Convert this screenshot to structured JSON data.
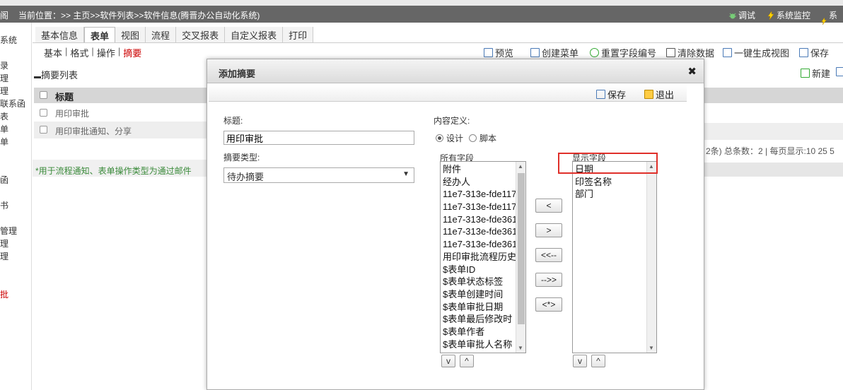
{
  "header": {
    "left_cut": "阁",
    "location": "当前位置：>> 主页>>软件列表>>软件信息(腾晋办公自动化系统)",
    "tools": [
      "调试",
      "系统监控",
      "系统"
    ]
  },
  "sidebar": {
    "items": [
      "系统",
      "录",
      "理",
      "理",
      "联系函",
      "表",
      "单",
      "单",
      "函",
      "书",
      "管理",
      "理",
      "理",
      "批"
    ]
  },
  "tabs": [
    "基本信息",
    "表单",
    "视图",
    "流程",
    "交叉报表",
    "自定义报表",
    "打印"
  ],
  "subtabs": {
    "items": [
      "基本",
      "格式",
      "操作",
      "摘要"
    ],
    "active": "摘要"
  },
  "toolbar": [
    "预览",
    "创建菜单",
    "重置字段编号",
    "清除数据",
    "一键生成视图",
    "保存"
  ],
  "list": {
    "title": "摘要列表",
    "header": "标题",
    "rows": [
      "用印审批",
      "用印审批通知、分享"
    ],
    "note": "*用于流程通知、表单操作类型为通过邮件"
  },
  "right_panel": {
    "new_label": "新建",
    "pager": "2条) 总条数：2 | 每页显示:10 25 5"
  },
  "dialog": {
    "title": "添加摘要",
    "save_label": "保存",
    "exit_label": "退出",
    "title_label": "标题:",
    "title_value": "用印审批",
    "type_label": "摘要类型:",
    "type_value": "待办摘要",
    "content_label": "内容定义:",
    "radio_design": "设计",
    "radio_script": "脚本",
    "all_fields_label": "所有字段",
    "display_fields_label": "显示字段",
    "all_fields": [
      "附件",
      "经办人",
      "11e7-313e-fde117",
      "11e7-313e-fde117",
      "11e7-313e-fde361",
      "11e7-313e-fde361",
      "11e7-313e-fde361",
      "用印审批流程历史",
      "$表单ID",
      "$表单状态标签",
      "$表单创建时间",
      "$表单审批日期",
      "$表单最后修改时",
      "$表单作者",
      "$表单审批人名称"
    ],
    "display_fields": [
      "日期",
      "印签名称",
      "部门"
    ],
    "move_buttons": [
      "<",
      ">",
      "<<--",
      "-->>",
      "<*>"
    ],
    "order_buttons": [
      "v",
      "^"
    ]
  },
  "colors": {
    "header_bg": "#666666",
    "highlight": "#e0302a",
    "active_subtab": "#cc0000",
    "note": "#3a8a3a"
  }
}
